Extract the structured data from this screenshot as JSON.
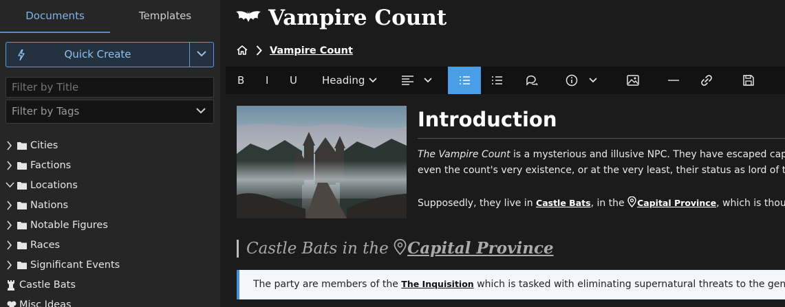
{
  "sidebar": {
    "tabs": [
      {
        "label": "Documents"
      },
      {
        "label": "Templates"
      }
    ],
    "quick_create": {
      "label": "Quick Create"
    },
    "filter_title": {
      "placeholder": "Filter by Title"
    },
    "filter_tags": {
      "placeholder": "Filter by Tags"
    },
    "tree": [
      {
        "label": "Cities"
      },
      {
        "label": "Factions"
      },
      {
        "label": "Locations"
      },
      {
        "label": "Nations"
      },
      {
        "label": "Notable Figures"
      },
      {
        "label": "Races"
      },
      {
        "label": "Significant Events"
      },
      {
        "label": "Castle Bats"
      },
      {
        "label": "Misc Ideas"
      }
    ]
  },
  "page": {
    "title": "Vampire Count",
    "breadcrumb": {
      "current": "Vampire Count"
    }
  },
  "toolbar": {
    "bold": "B",
    "italic": "I",
    "underline": "U",
    "heading": "Heading"
  },
  "content": {
    "intro_heading": "Introduction",
    "p1_em": "The Vampire Count",
    "p1_rest": " is a mysterious and illusive NPC. They have escaped captu",
    "p1_line2": "even the count's very existence, or at the very least, their status as lord of the",
    "p2_pre": "Supposedly, they live in ",
    "p2_link1": "Castle Bats",
    "p2_mid": ", in the ",
    "p2_link2": "Capital Province",
    "p2_post": ", which is thought t",
    "castle_heading_pre": "Castle Bats in the ",
    "castle_heading_link": "Capital Province",
    "callout_pre": "The party are members of the ",
    "callout_link": "The Inquisition",
    "callout_post": " which is tasked with eliminating supernatural threats to the general"
  },
  "colors": {
    "accent": "#4a90d9",
    "active_tool": "#4a9ee8"
  }
}
